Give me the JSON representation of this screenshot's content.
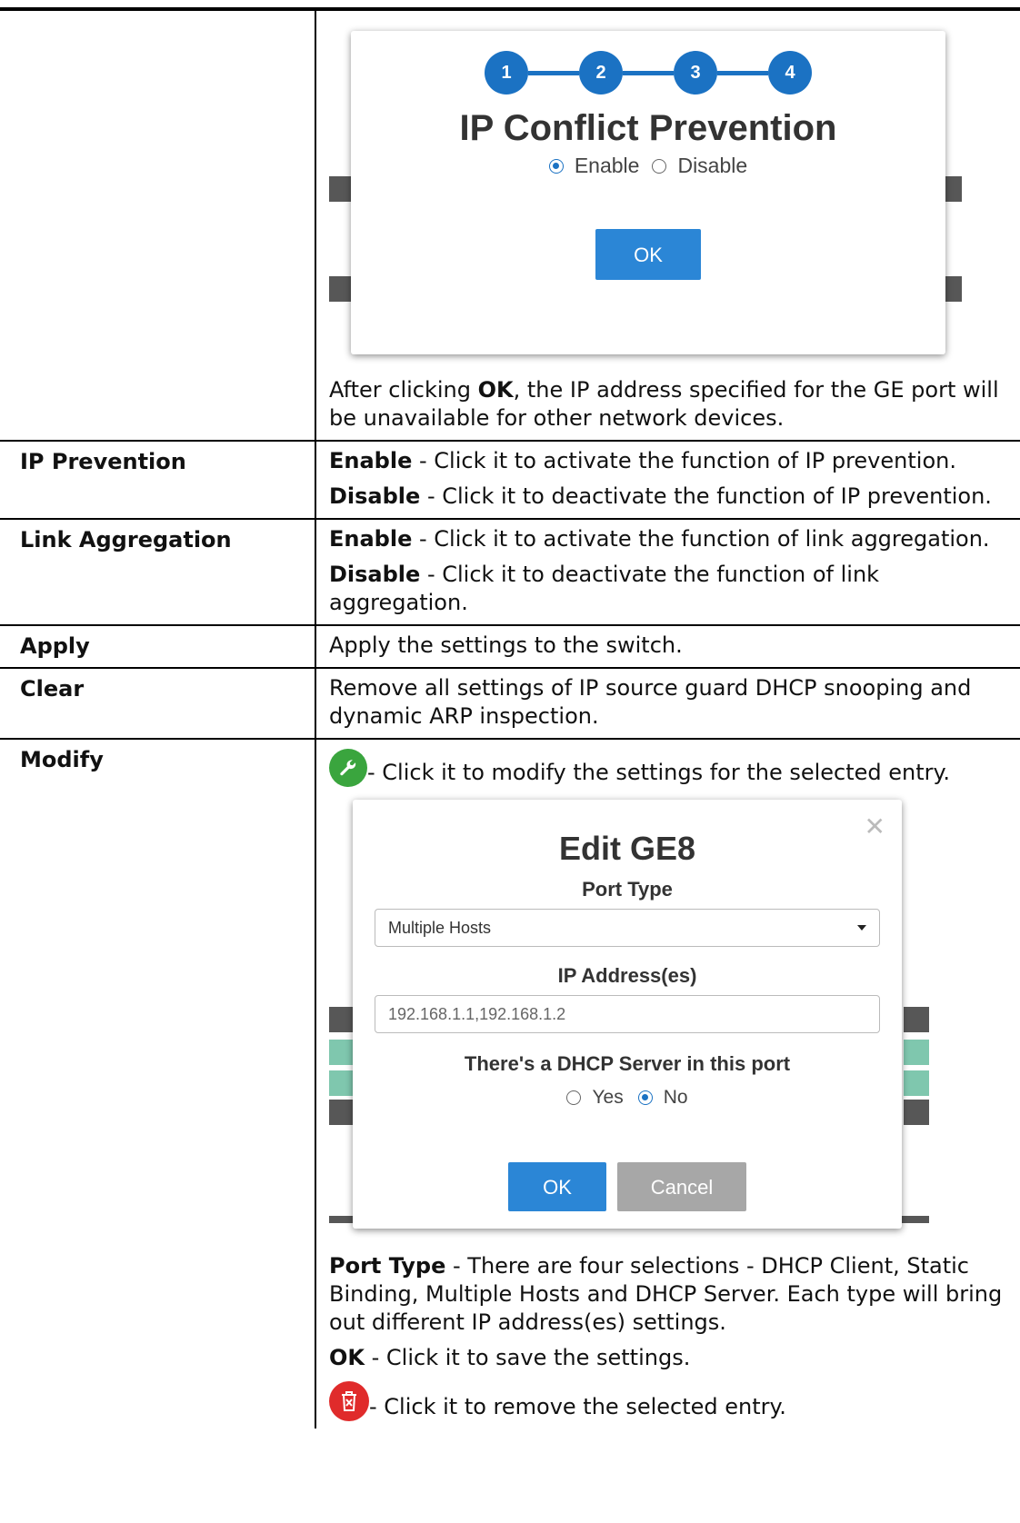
{
  "row0": {
    "dialog": {
      "steps": [
        "1",
        "2",
        "3",
        "4"
      ],
      "title": "IP Conflict Prevention",
      "enable": "Enable",
      "disable": "Disable",
      "ok": "OK"
    },
    "text": {
      "before": "After clicking ",
      "ok": "OK",
      "after": ", the IP address specified for the GE port will be unavailable for other network devices."
    }
  },
  "rows": {
    "ip_prevention": {
      "label": "IP Prevention",
      "enable_term": "Enable",
      "enable_desc": " - Click it to activate the function of IP prevention.",
      "disable_term": "Disable",
      "disable_desc": " - Click it to deactivate the function of IP prevention."
    },
    "link_aggregation": {
      "label": "Link Aggregation",
      "enable_term": "Enable",
      "enable_desc": " - Click it to activate the function of link aggregation.",
      "disable_term": "Disable",
      "disable_desc": " - Click it to deactivate the function of link aggregation."
    },
    "apply": {
      "label": "Apply",
      "desc": "Apply the settings to the switch."
    },
    "clear": {
      "label": "Clear",
      "desc": "Remove all settings of IP source guard DHCP snooping and dynamic ARP inspection."
    },
    "modify": {
      "label": "Modify",
      "wrench_desc": "- Click it to modify the settings for the selected entry.",
      "dialog": {
        "title": "Edit GE8",
        "port_type_label": "Port Type",
        "port_type_value": "Multiple Hosts",
        "ip_label": "IP Address(es)",
        "ip_value": "192.168.1.1,192.168.1.2",
        "dhcp_label": "There's a DHCP Server in this port",
        "yes": "Yes",
        "no": "No",
        "ok": "OK",
        "cancel": "Cancel"
      },
      "port_type_term": "Port Type",
      "port_type_desc": " - There are four selections - DHCP Client, Static Binding, Multiple Hosts and DHCP Server. Each type will bring out different IP address(es) settings.",
      "ok_term": "OK",
      "ok_desc": " - Click it to save the settings.",
      "trash_desc": "- Click it to remove the selected entry."
    }
  }
}
